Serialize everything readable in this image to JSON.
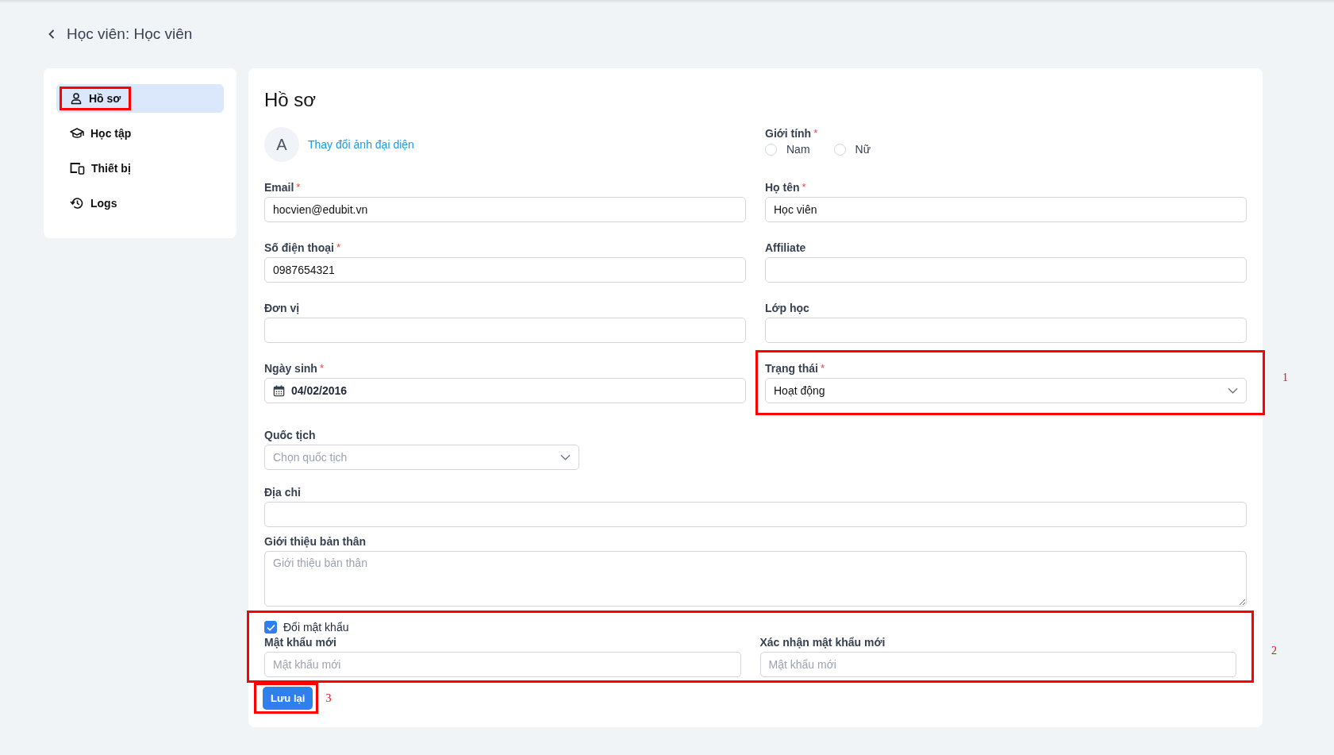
{
  "header": {
    "title": "Học viên: Học viên"
  },
  "sidebar": {
    "items": [
      {
        "label": "Hồ sơ",
        "selected": true,
        "highlighted": true
      },
      {
        "label": "Học tập",
        "selected": false,
        "highlighted": false
      },
      {
        "label": "Thiết bị",
        "selected": false,
        "highlighted": false
      },
      {
        "label": "Logs",
        "selected": false,
        "highlighted": false
      }
    ]
  },
  "profile": {
    "title": "Hồ sơ",
    "avatar_letter": "A",
    "change_avatar_link": "Thay đổi ảnh đại diện",
    "gender": {
      "label": "Giới tính",
      "required_mark": "*",
      "options": [
        {
          "label": "Nam",
          "selected": false
        },
        {
          "label": "Nữ",
          "selected": false
        }
      ]
    },
    "fields": [
      {
        "kind": "text",
        "label": "Email",
        "required_mark": "*",
        "value": "hocvien@edubit.vn"
      },
      {
        "kind": "text",
        "label": "Họ tên",
        "required_mark": "*",
        "value": "Học viên"
      },
      {
        "kind": "text",
        "label": "Số điện thoại",
        "required_mark": "*",
        "value": "0987654321"
      },
      {
        "kind": "text",
        "label": "Affiliate"
      },
      {
        "kind": "text",
        "label": "Đơn vị"
      },
      {
        "kind": "text",
        "label": "Lớp học"
      },
      {
        "kind": "date",
        "label": "Ngày sinh",
        "required_mark": "*",
        "value": "04/02/2016"
      },
      {
        "kind": "select",
        "label": "Trạng thái",
        "required_mark": "*",
        "value": "Hoạt động",
        "annotation": "1"
      },
      {
        "kind": "select",
        "label": "Quốc tịch",
        "placeholder": "Chọn quốc tịch"
      },
      {
        "kind": "text",
        "label": "Địa chỉ"
      },
      {
        "kind": "textarea",
        "label": "Giới thiệu bản thân",
        "placeholder": "Giới thiệu bản thân"
      }
    ],
    "password_section": {
      "annotation": "2",
      "checkbox": {
        "label": "Đổi mật khẩu",
        "checked": true
      },
      "fields": [
        {
          "label": "Mật khẩu mới",
          "placeholder": "Mật khẩu mới"
        },
        {
          "label": "Xác nhận mật khẩu mới",
          "placeholder": "Mật khẩu mới"
        }
      ]
    },
    "save_button": {
      "label": "Lưu lại",
      "annotation": "3"
    }
  }
}
